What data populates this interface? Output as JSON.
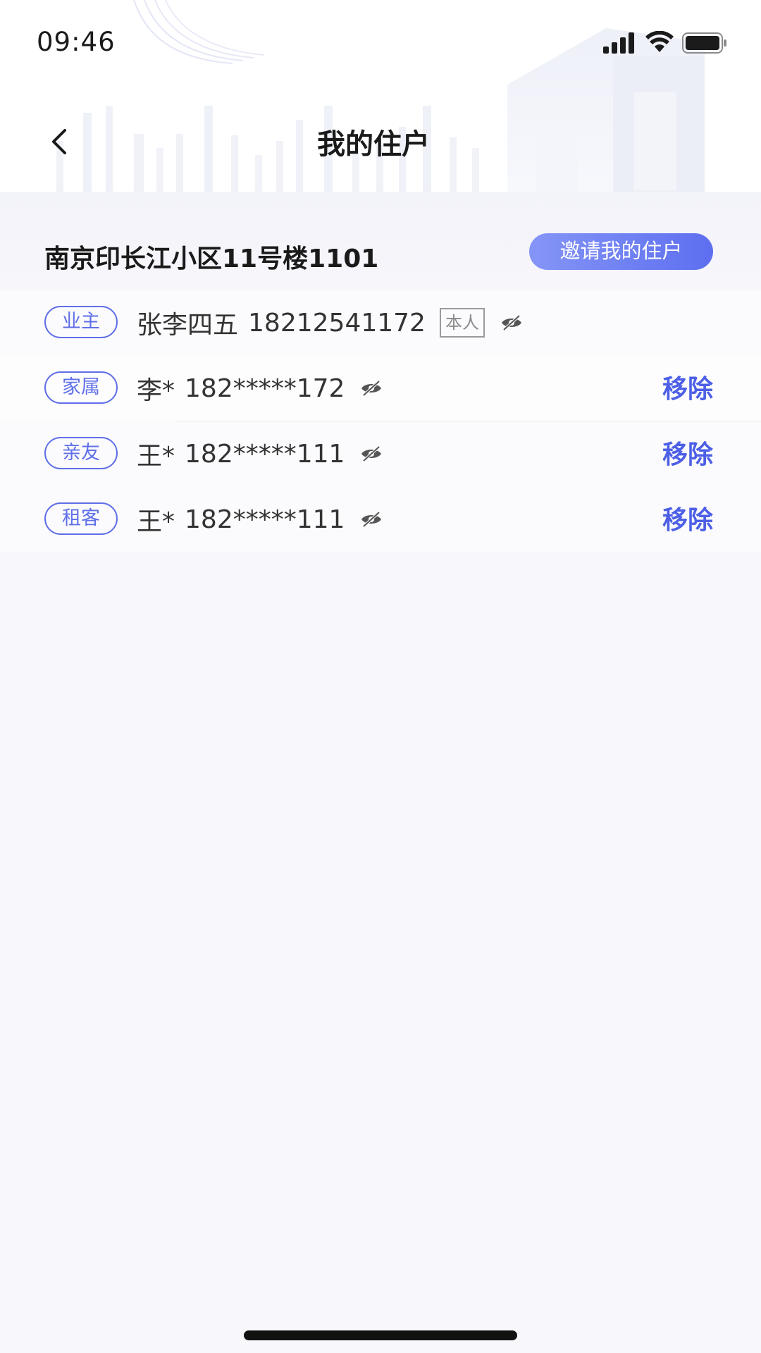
{
  "status_bar": {
    "time": "09:46",
    "icons": [
      "signal-icon",
      "wifi-icon",
      "battery-icon"
    ]
  },
  "nav": {
    "back_icon": "chevron-left-icon",
    "title": "我的住户"
  },
  "address": {
    "text": "南京印长江小区11号楼1101",
    "invite_label": "邀请我的住户"
  },
  "residents": [
    {
      "role": "业主",
      "name": "张李四五",
      "phone": "18212541172",
      "self_tag": "本人",
      "visibility_icon": "eye-hidden-icon",
      "remove_label": ""
    },
    {
      "role": "家属",
      "name": "李*",
      "phone": "182*****172",
      "self_tag": "",
      "visibility_icon": "eye-hidden-icon",
      "remove_label": "移除"
    },
    {
      "role": "亲友",
      "name": "王*",
      "phone": "182*****111",
      "self_tag": "",
      "visibility_icon": "eye-hidden-icon",
      "remove_label": "移除"
    },
    {
      "role": "租客",
      "name": "王*",
      "phone": "182*****111",
      "self_tag": "",
      "visibility_icon": "eye-hidden-icon",
      "remove_label": "移除"
    }
  ],
  "colors": {
    "accent": "#5f6fe8",
    "remove": "#4d5fe6",
    "invite_gradient_start": "#8595f6",
    "invite_gradient_end": "#5d6ff0",
    "background": "#f8f7fb"
  }
}
